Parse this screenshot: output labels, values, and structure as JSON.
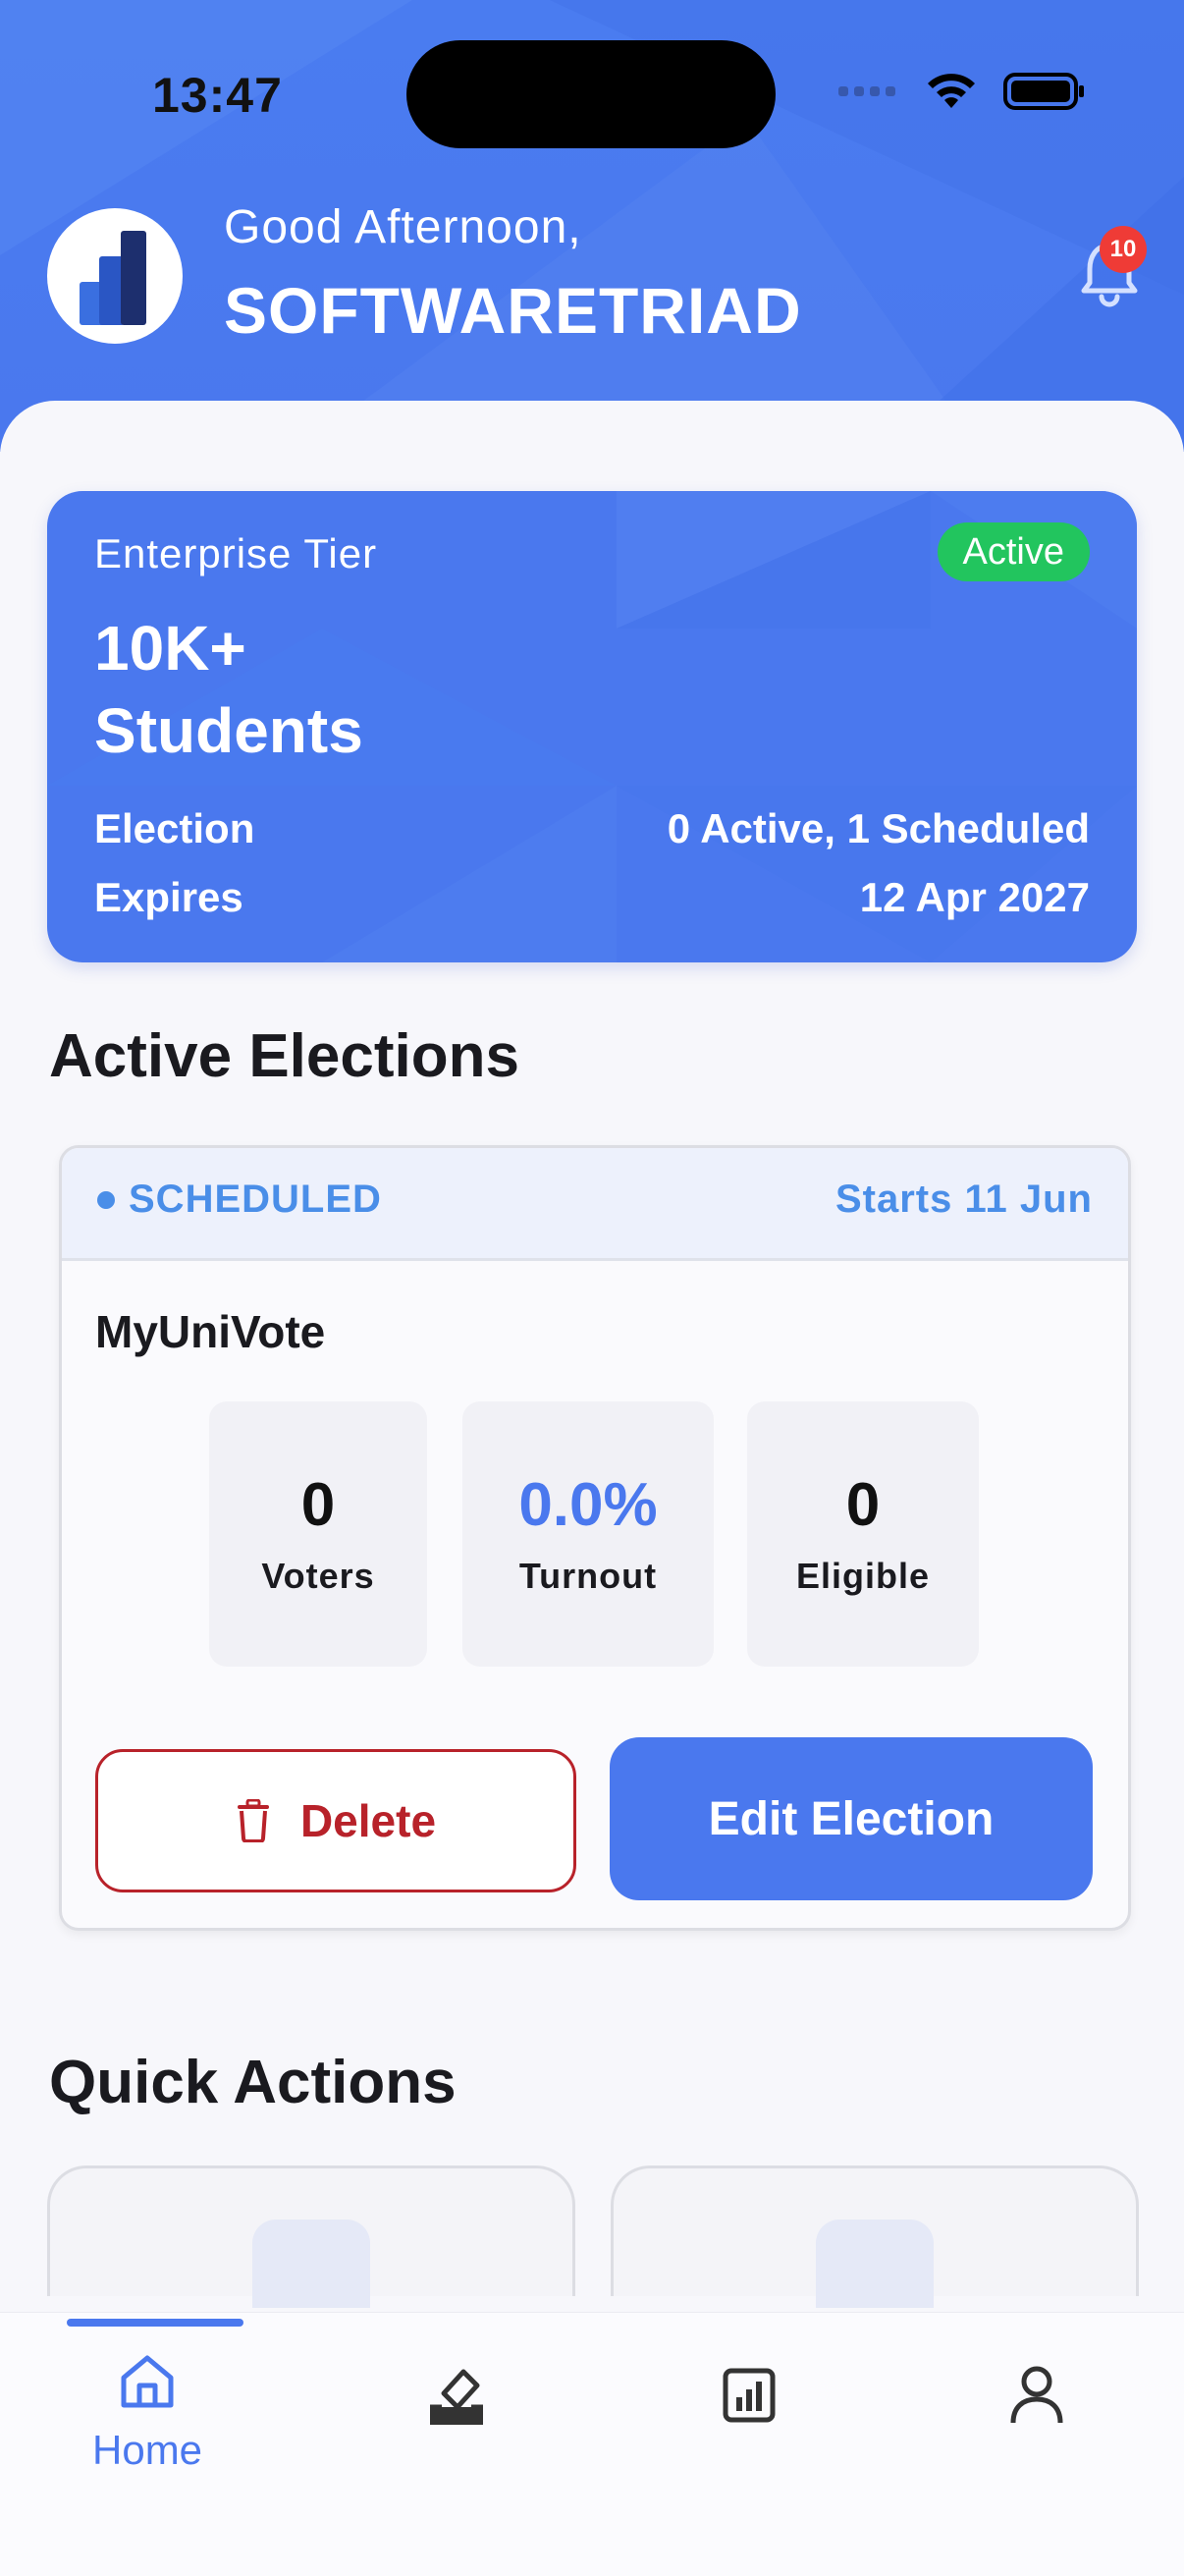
{
  "status_bar": {
    "time": "13:47"
  },
  "header": {
    "greeting": "Good Afternoon,",
    "username": "SOFTWARETRIAD",
    "notification_count": "10"
  },
  "tier_card": {
    "tier_label": "Enterprise Tier",
    "status_pill": "Active",
    "title_line1": "10K+",
    "title_line2": "Students",
    "election_label": "Election",
    "election_value": "0 Active, 1 Scheduled",
    "expires_label": "Expires",
    "expires_value": "12 Apr 2027"
  },
  "sections": {
    "active_elections": "Active Elections",
    "quick_actions": "Quick Actions"
  },
  "election": {
    "status": "SCHEDULED",
    "starts": "Starts 11 Jun",
    "name": "MyUniVote",
    "stats": [
      {
        "value": "0",
        "label": "Voters"
      },
      {
        "value": "0.0%",
        "label": "Turnout"
      },
      {
        "value": "0",
        "label": "Eligible"
      }
    ],
    "delete_label": "Delete",
    "edit_label": "Edit Election"
  },
  "bottom_nav": {
    "items": [
      {
        "label": "Home",
        "icon": "home-icon",
        "active": true
      },
      {
        "icon": "vote-icon"
      },
      {
        "icon": "chart-icon"
      },
      {
        "icon": "profile-icon"
      }
    ]
  },
  "colors": {
    "primary": "#4a78ee",
    "active_green": "#22c55e",
    "danger": "#b8222a",
    "scheduled_blue": "#4a8ee8",
    "badge_red": "#ef3b36"
  }
}
